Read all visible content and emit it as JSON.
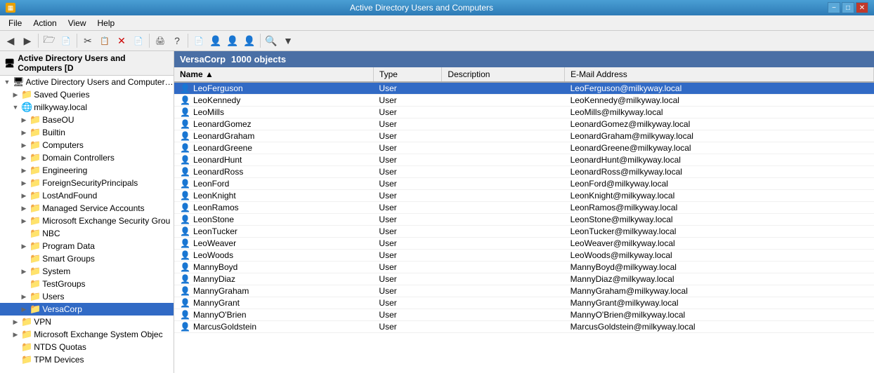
{
  "titleBar": {
    "title": "Active Directory Users and Computers",
    "minimizeLabel": "−",
    "maximizeLabel": "□",
    "closeLabel": "✕"
  },
  "menuBar": {
    "items": [
      "File",
      "Action",
      "View",
      "Help"
    ]
  },
  "toolbar": {
    "buttons": [
      "◀",
      "▶",
      "🗁",
      "📄",
      "✂",
      "📋",
      "✕",
      "📄",
      "🖨",
      "?",
      "📄",
      "👤",
      "👤",
      "👤",
      "🔍",
      "▼"
    ]
  },
  "treeHeader": {
    "label": "Active Directory Users and Computers [D"
  },
  "treeItems": [
    {
      "level": 0,
      "label": "Active Directory Users and Computers [D",
      "expanded": true,
      "hasChildren": true,
      "icon": "🖥"
    },
    {
      "level": 1,
      "label": "Saved Queries",
      "expanded": false,
      "hasChildren": true,
      "icon": "📁"
    },
    {
      "level": 1,
      "label": "milkyway.local",
      "expanded": true,
      "hasChildren": true,
      "icon": "🌐"
    },
    {
      "level": 2,
      "label": "BaseOU",
      "expanded": false,
      "hasChildren": true,
      "icon": "📁"
    },
    {
      "level": 2,
      "label": "Builtin",
      "expanded": false,
      "hasChildren": true,
      "icon": "📁"
    },
    {
      "level": 2,
      "label": "Computers",
      "expanded": false,
      "hasChildren": true,
      "icon": "📁"
    },
    {
      "level": 2,
      "label": "Domain Controllers",
      "expanded": false,
      "hasChildren": true,
      "icon": "📁"
    },
    {
      "level": 2,
      "label": "Engineering",
      "expanded": false,
      "hasChildren": true,
      "icon": "📁"
    },
    {
      "level": 2,
      "label": "ForeignSecurityPrincipals",
      "expanded": false,
      "hasChildren": true,
      "icon": "📁"
    },
    {
      "level": 2,
      "label": "LostAndFound",
      "expanded": false,
      "hasChildren": true,
      "icon": "📁"
    },
    {
      "level": 2,
      "label": "Managed Service Accounts",
      "expanded": false,
      "hasChildren": true,
      "icon": "📁"
    },
    {
      "level": 2,
      "label": "Microsoft Exchange Security Grou",
      "expanded": false,
      "hasChildren": true,
      "icon": "📁"
    },
    {
      "level": 2,
      "label": "NBC",
      "expanded": false,
      "hasChildren": false,
      "icon": "📁"
    },
    {
      "level": 2,
      "label": "Program Data",
      "expanded": false,
      "hasChildren": true,
      "icon": "📁"
    },
    {
      "level": 2,
      "label": "Smart Groups",
      "expanded": false,
      "hasChildren": false,
      "icon": "📁"
    },
    {
      "level": 2,
      "label": "System",
      "expanded": false,
      "hasChildren": true,
      "icon": "📁"
    },
    {
      "level": 2,
      "label": "TestGroups",
      "expanded": false,
      "hasChildren": false,
      "icon": "📁"
    },
    {
      "level": 2,
      "label": "Users",
      "expanded": false,
      "hasChildren": true,
      "icon": "📁"
    },
    {
      "level": 2,
      "label": "VersaCorp",
      "expanded": false,
      "hasChildren": true,
      "icon": "📁",
      "selected": true
    },
    {
      "level": 1,
      "label": "VPN",
      "expanded": false,
      "hasChildren": true,
      "icon": "📁"
    },
    {
      "level": 1,
      "label": "Microsoft Exchange System Objec",
      "expanded": false,
      "hasChildren": true,
      "icon": "📁"
    },
    {
      "level": 1,
      "label": "NTDS Quotas",
      "expanded": false,
      "hasChildren": false,
      "icon": "📁"
    },
    {
      "level": 1,
      "label": "TPM Devices",
      "expanded": false,
      "hasChildren": false,
      "icon": "📁"
    }
  ],
  "contentHeader": {
    "folder": "VersaCorp",
    "count": "1000 objects"
  },
  "tableColumns": [
    {
      "label": "Name",
      "sorted": true
    },
    {
      "label": "Type"
    },
    {
      "label": "Description"
    },
    {
      "label": "E-Mail Address"
    }
  ],
  "tableRows": [
    {
      "name": "LeoFerguson",
      "type": "User",
      "description": "",
      "email": "LeoFerguson@milkyway.local",
      "selected": true
    },
    {
      "name": "LeoKennedy",
      "type": "User",
      "description": "",
      "email": "LeoKennedy@milkyway.local"
    },
    {
      "name": "LeoMills",
      "type": "User",
      "description": "",
      "email": "LeoMills@milkyway.local"
    },
    {
      "name": "LeonardGomez",
      "type": "User",
      "description": "",
      "email": "LeonardGomez@milkyway.local"
    },
    {
      "name": "LeonardGraham",
      "type": "User",
      "description": "",
      "email": "LeonardGraham@milkyway.local"
    },
    {
      "name": "LeonardGreene",
      "type": "User",
      "description": "",
      "email": "LeonardGreene@milkyway.local"
    },
    {
      "name": "LeonardHunt",
      "type": "User",
      "description": "",
      "email": "LeonardHunt@milkyway.local"
    },
    {
      "name": "LeonardRoss",
      "type": "User",
      "description": "",
      "email": "LeonardRoss@milkyway.local"
    },
    {
      "name": "LeonFord",
      "type": "User",
      "description": "",
      "email": "LeonFord@milkyway.local"
    },
    {
      "name": "LeonKnight",
      "type": "User",
      "description": "",
      "email": "LeonKnight@milkyway.local"
    },
    {
      "name": "LeonRamos",
      "type": "User",
      "description": "",
      "email": "LeonRamos@milkyway.local"
    },
    {
      "name": "LeonStone",
      "type": "User",
      "description": "",
      "email": "LeonStone@milkyway.local"
    },
    {
      "name": "LeonTucker",
      "type": "User",
      "description": "",
      "email": "LeonTucker@milkyway.local"
    },
    {
      "name": "LeoWeaver",
      "type": "User",
      "description": "",
      "email": "LeoWeaver@milkyway.local"
    },
    {
      "name": "LeoWoods",
      "type": "User",
      "description": "",
      "email": "LeoWoods@milkyway.local"
    },
    {
      "name": "MannyBoyd",
      "type": "User",
      "description": "",
      "email": "MannyBoyd@milkyway.local"
    },
    {
      "name": "MannyDiaz",
      "type": "User",
      "description": "",
      "email": "MannyDiaz@milkyway.local"
    },
    {
      "name": "MannyGraham",
      "type": "User",
      "description": "",
      "email": "MannyGraham@milkyway.local"
    },
    {
      "name": "MannyGrant",
      "type": "User",
      "description": "",
      "email": "MannyGrant@milkyway.local"
    },
    {
      "name": "MannyO'Brien",
      "type": "User",
      "description": "",
      "email": "MannyO'Brien@milkyway.local"
    },
    {
      "name": "MarcusGoldstein",
      "type": "User",
      "description": "",
      "email": "MarcusGoldstein@milkyway.local"
    }
  ]
}
